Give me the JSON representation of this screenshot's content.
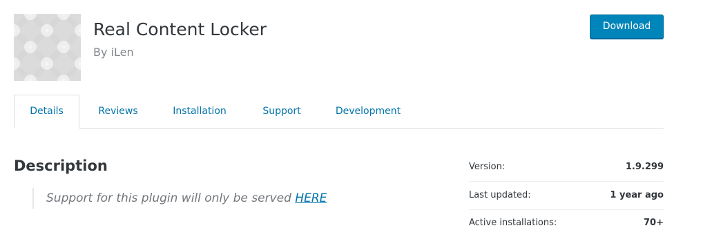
{
  "plugin": {
    "title": "Real Content Locker",
    "author": "By iLen",
    "download_label": "Download"
  },
  "tabs": [
    {
      "label": "Details",
      "active": true
    },
    {
      "label": "Reviews",
      "active": false
    },
    {
      "label": "Installation",
      "active": false
    },
    {
      "label": "Support",
      "active": false
    },
    {
      "label": "Development",
      "active": false
    }
  ],
  "description": {
    "heading": "Description",
    "quote_text": "Support for this plugin will only be served ",
    "quote_link": "HERE"
  },
  "meta": [
    {
      "label": "Version:",
      "value": "1.9.299"
    },
    {
      "label": "Last updated:",
      "value": "1 year ago"
    },
    {
      "label": "Active installations:",
      "value": "70+"
    }
  ],
  "colors": {
    "accent": "#0073aa",
    "button": "#0085ba",
    "text": "#32373c",
    "muted": "#82878c"
  }
}
